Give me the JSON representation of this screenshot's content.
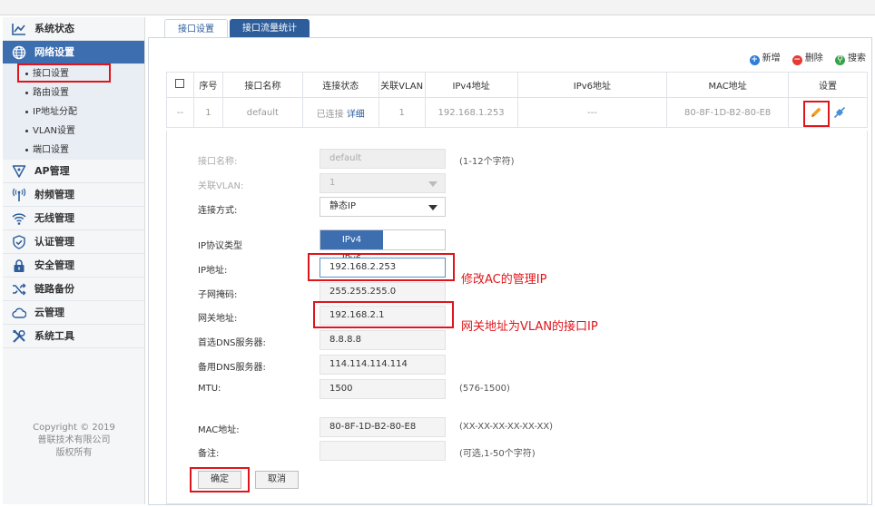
{
  "sidebar": {
    "items": [
      {
        "label": "系统状态",
        "icon": "chart-line-icon"
      },
      {
        "label": "网络设置",
        "icon": "globe-icon",
        "active": true
      },
      {
        "label": "AP管理",
        "icon": "ap-icon"
      },
      {
        "label": "射频管理",
        "icon": "antenna-icon"
      },
      {
        "label": "无线管理",
        "icon": "wifi-icon"
      },
      {
        "label": "认证管理",
        "icon": "shield-check-icon"
      },
      {
        "label": "安全管理",
        "icon": "lock-icon"
      },
      {
        "label": "链路备份",
        "icon": "shuffle-icon"
      },
      {
        "label": "云管理",
        "icon": "cloud-icon"
      },
      {
        "label": "系统工具",
        "icon": "tools-icon"
      }
    ],
    "subitems": [
      "接口设置",
      "路由设置",
      "IP地址分配",
      "VLAN设置",
      "端口设置"
    ],
    "copyright": [
      "Copyright © 2019",
      "普联技术有限公司",
      "版权所有"
    ]
  },
  "tabs": [
    "接口设置",
    "接口流量统计"
  ],
  "actions": {
    "add": "新增",
    "delete": "删除",
    "search": "搜索"
  },
  "table": {
    "headers": [
      "序号",
      "接口名称",
      "连接状态",
      "关联VLAN",
      "IPv4地址",
      "IPv6地址",
      "MAC地址",
      "设置"
    ],
    "row": {
      "check": "--",
      "index": "1",
      "name": "default",
      "status": "已连接",
      "detail": "详细",
      "vlan": "1",
      "ipv4": "192.168.1.253",
      "ipv6": "---",
      "mac": "80-8F-1D-B2-80-E8"
    }
  },
  "form": {
    "labels": {
      "name": "接口名称:",
      "vlan": "关联VLAN:",
      "conn": "连接方式:",
      "proto": "IP协议类型",
      "ip": "IP地址:",
      "mask": "子网掩码:",
      "gw": "网关地址:",
      "dns1": "首选DNS服务器:",
      "dns2": "备用DNS服务器:",
      "mtu": "MTU:",
      "mac": "MAC地址:",
      "note": "备注:"
    },
    "values": {
      "name": "default",
      "vlan": "1",
      "conn": "静态IP",
      "ip": "192.168.2.253",
      "mask": "255.255.255.0",
      "gw": "192.168.2.1",
      "dns1": "8.8.8.8",
      "dns2": "114.114.114.114",
      "mtu": "1500",
      "mac": "80-8F-1D-B2-80-E8",
      "note": ""
    },
    "proto_options": [
      "IPv4",
      "IPv6"
    ],
    "hints": {
      "name": "(1-12个字符)",
      "mtu": "(576-1500)",
      "mac": "(XX-XX-XX-XX-XX-XX)",
      "note": "(可选,1-50个字符)"
    },
    "buttons": {
      "ok": "确定",
      "cancel": "取消"
    }
  },
  "annotations": {
    "ip_note": "修改AC的管理IP",
    "gw_note": "网关地址为VLAN的接口IP"
  },
  "colors": {
    "accent": "#3d6eb0",
    "annotation": "#e0151b"
  }
}
